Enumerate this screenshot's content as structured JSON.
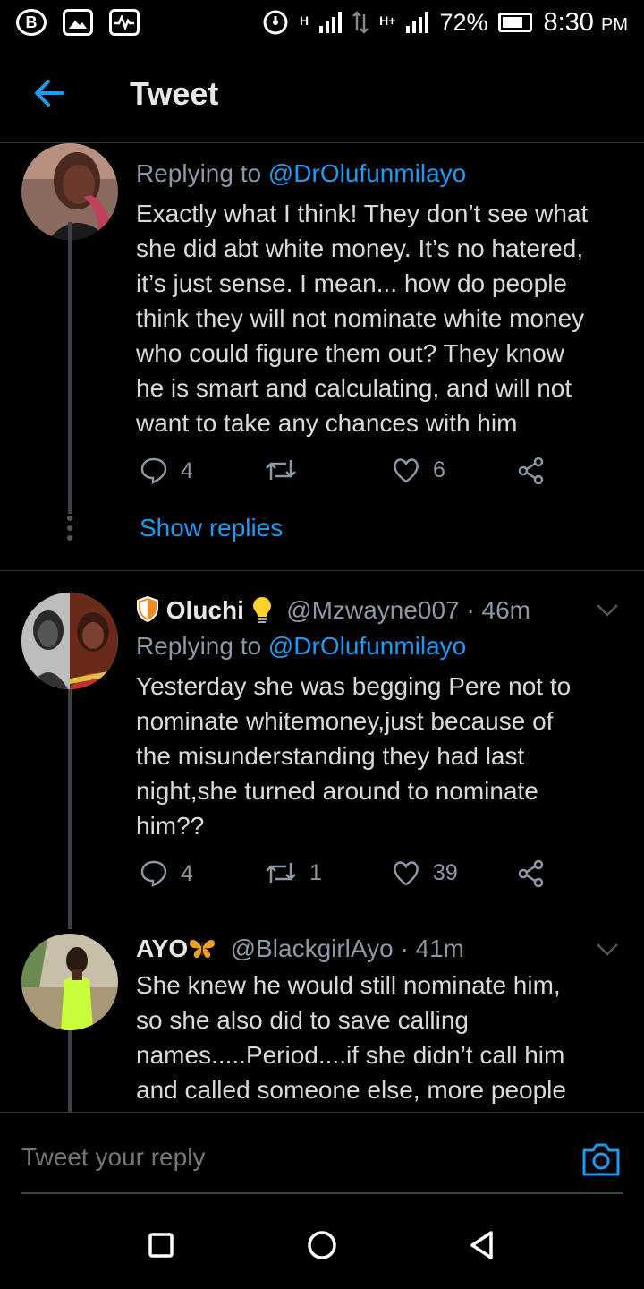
{
  "status_bar": {
    "network_label": "H",
    "network_label_2": "H+",
    "battery": "72%",
    "time": "8:30",
    "ampm": "PM"
  },
  "header": {
    "title": "Tweet",
    "back_icon": "arrow-left-icon"
  },
  "tweets": [
    {
      "replying_prefix": "Replying to ",
      "replying_to": "@DrOlufunmilayo",
      "text_lines": [
        "Exactly what I think! They don’t see what",
        "she did abt white money. It’s no hatered,",
        "it’s just sense. I mean... how do people",
        "think they will not nominate white money",
        "who could figure them out? They know",
        "he is smart and calculating, and will not",
        "want to take any chances with him"
      ],
      "replies": "4",
      "retweets": "",
      "likes": "6",
      "show_replies": "Show replies"
    },
    {
      "name": "Oluchi",
      "name_prefix_icon": "shield-icon",
      "name_suffix_icon": "lightbulb-icon",
      "handle": "@Mzwayne007",
      "time": "· 46m",
      "replying_prefix": "Replying to ",
      "replying_to": "@DrOlufunmilayo",
      "text_lines": [
        "Yesterday she was begging Pere not to",
        "nominate whitemoney,just because of",
        "the misunderstanding they had last",
        "night,she turned around to nominate",
        "him??"
      ],
      "replies": "4",
      "retweets": "1",
      "likes": "39"
    },
    {
      "name": "AYO",
      "name_suffix_icon": "butterfly-icon",
      "handle": "@BlackgirlAyo",
      "time": "· 41m",
      "text_lines": [
        "She knew he would still nominate him,",
        "so she also did to save calling",
        "names.....Period....if she didn’t call him",
        "and called someone else, more people"
      ]
    }
  ],
  "reply_bar": {
    "placeholder": "Tweet your reply",
    "camera_icon": "camera-icon"
  },
  "colors": {
    "background": "#000000",
    "accent": "#1d9bf0",
    "secondary_text": "#8b98a5",
    "divider": "#2f3336"
  }
}
